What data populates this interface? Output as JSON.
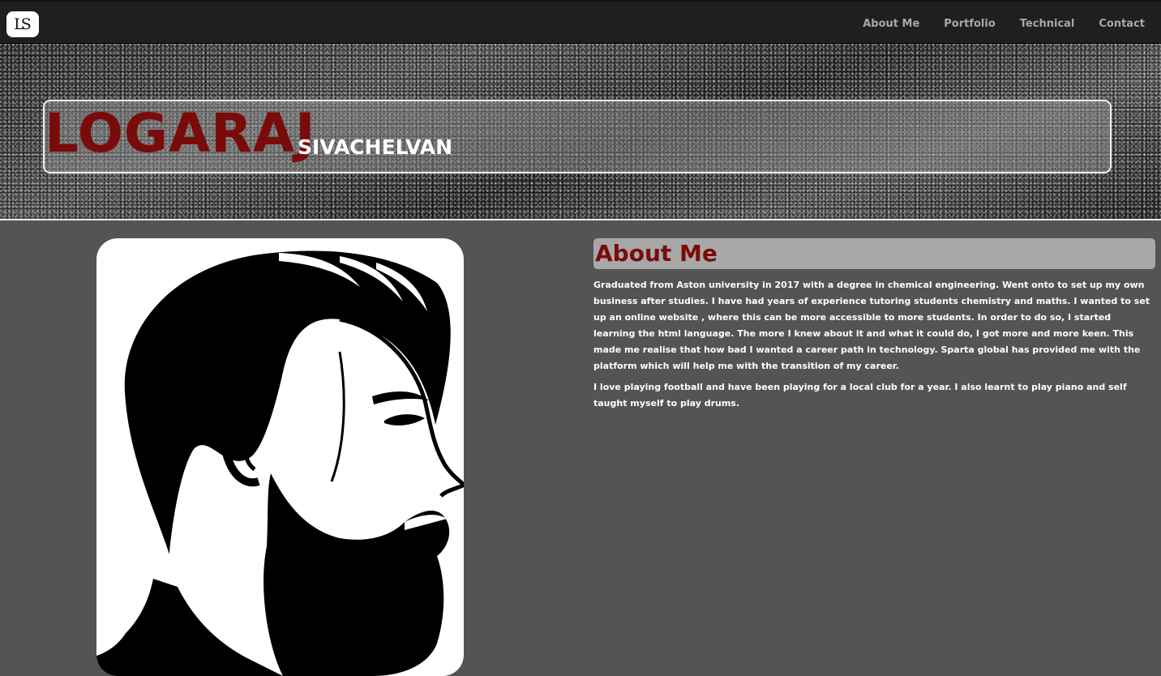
{
  "nav": {
    "logo_text": "LS",
    "links": [
      "About Me",
      "Portfolio",
      "Technical",
      "Contact"
    ]
  },
  "hero": {
    "first_name": "LOGARAJ",
    "last_name": "SIVACHELVAN"
  },
  "about": {
    "heading": "About Me",
    "paragraphs": [
      "Graduated from Aston university in 2017 with a degree in chemical engineering. Went onto to set up my own business after studies. I have had years of experience tutoring students chemistry and maths. I wanted to set up an online website , where this can be more accessible to more students. In order to do so, I started learning the html language. The more I knew about it and what it could do, I got more and more keen. This made me realise that how bad I wanted a career path in technology. Sparta global has provided me with the platform which will help me with the transition of my career.",
      "I love playing football and have been playing for a local club for a year. I also learnt to play piano and self taught myself to play drums."
    ]
  },
  "portrait": {
    "icon": "bearded-man-profile-icon"
  },
  "colors": {
    "accent": "#7a0b0b",
    "page_bg": "#545454",
    "nav_bg": "#1f1f1f",
    "heading_bar": "#a8a8a8"
  }
}
